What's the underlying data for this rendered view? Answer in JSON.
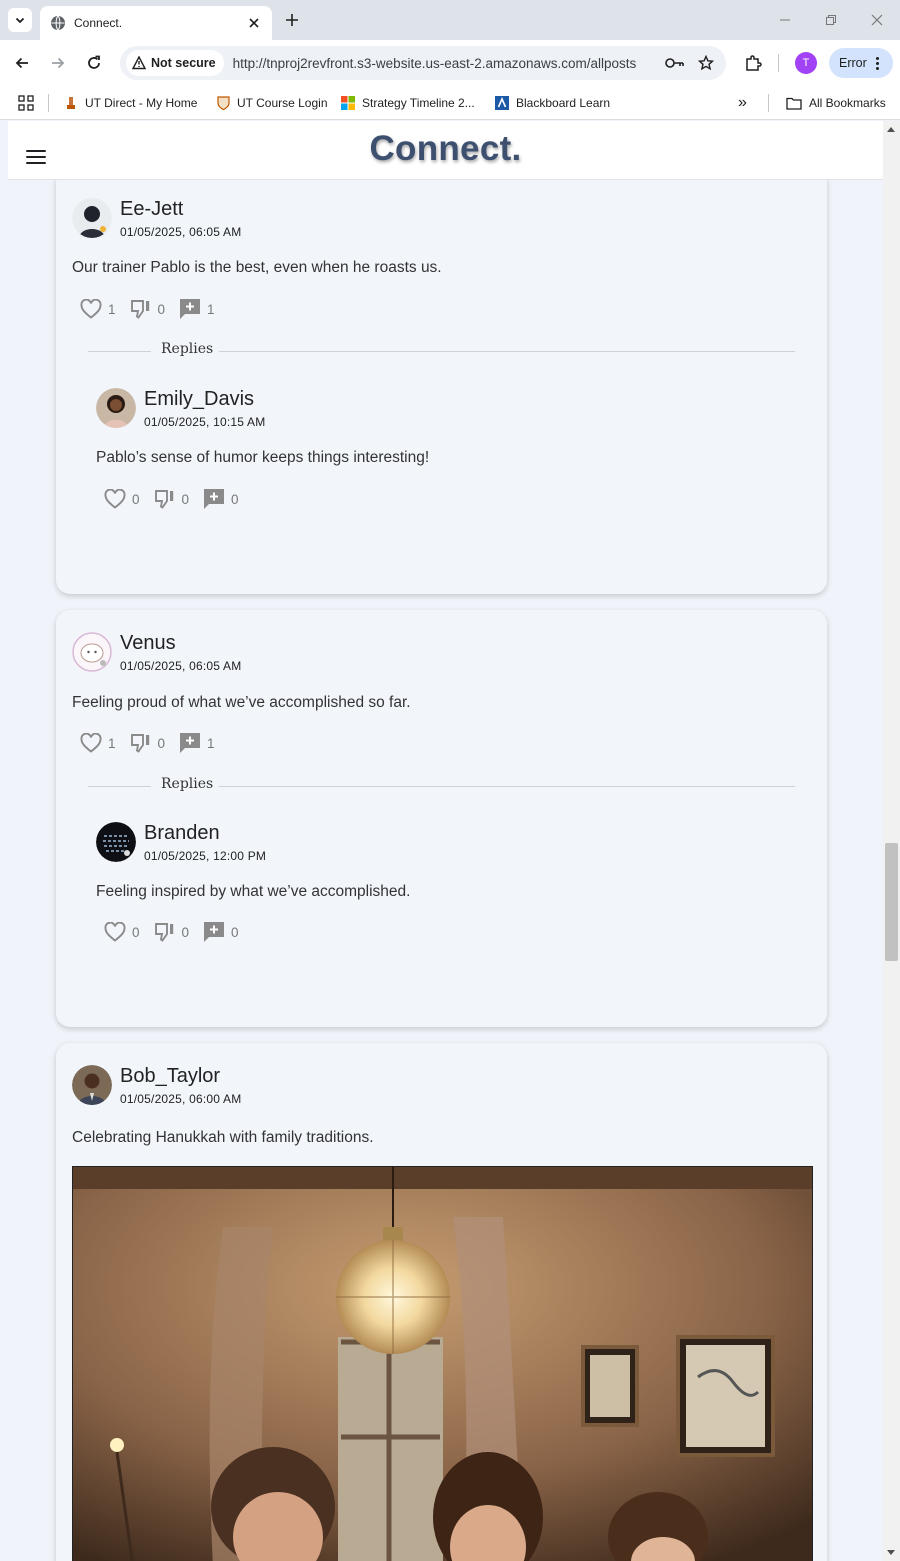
{
  "browser": {
    "tab_title": "Connect.",
    "security_label": "Not secure",
    "url": "http://tnproj2revfront.s3-website.us-east-2.amazonaws.com/allposts",
    "profile_initial": "T",
    "menu_label": "Error",
    "bookmarks": [
      {
        "label": "UT Direct - My Home",
        "icon": "ut-tower-icon"
      },
      {
        "label": "UT Course Login",
        "icon": "ut-shield-icon"
      },
      {
        "label": "Strategy Timeline 2...",
        "icon": "microsoft-icon"
      },
      {
        "label": "Blackboard Learn",
        "icon": "blackboard-icon"
      }
    ],
    "all_bookmarks_label": "All Bookmarks",
    "overflow_label": "»"
  },
  "app": {
    "brand": "Connect."
  },
  "posts": [
    {
      "username": "Ee-Jett",
      "timestamp": "01/05/2025, 06:05 AM",
      "text": "Our trainer Pablo is the best, even when he roasts us.",
      "likes": "1",
      "dislikes": "0",
      "comments": "1",
      "replies_label": "Replies",
      "reply": {
        "username": "Emily_Davis",
        "timestamp": "01/05/2025, 10:15 AM",
        "text": "Pablo’s sense of humor keeps things interesting!",
        "likes": "0",
        "dislikes": "0",
        "comments": "0"
      }
    },
    {
      "username": "Venus",
      "timestamp": "01/05/2025, 06:05 AM",
      "text": "Feeling proud of what we’ve accomplished so far.",
      "likes": "1",
      "dislikes": "0",
      "comments": "1",
      "replies_label": "Replies",
      "reply": {
        "username": "Branden",
        "timestamp": "01/05/2025, 12:00 PM",
        "text": "Feeling inspired by what we’ve accomplished.",
        "likes": "0",
        "dislikes": "0",
        "comments": "0"
      }
    },
    {
      "username": "Bob_Taylor",
      "timestamp": "01/05/2025, 06:00 AM",
      "text": "Celebrating Hanukkah with family traditions."
    }
  ],
  "colors": {
    "brand": "#3d5070",
    "card_bg": "#f2f6fb",
    "page_bg": "#f0f4fa",
    "icon_gray": "#8a8a8a"
  }
}
